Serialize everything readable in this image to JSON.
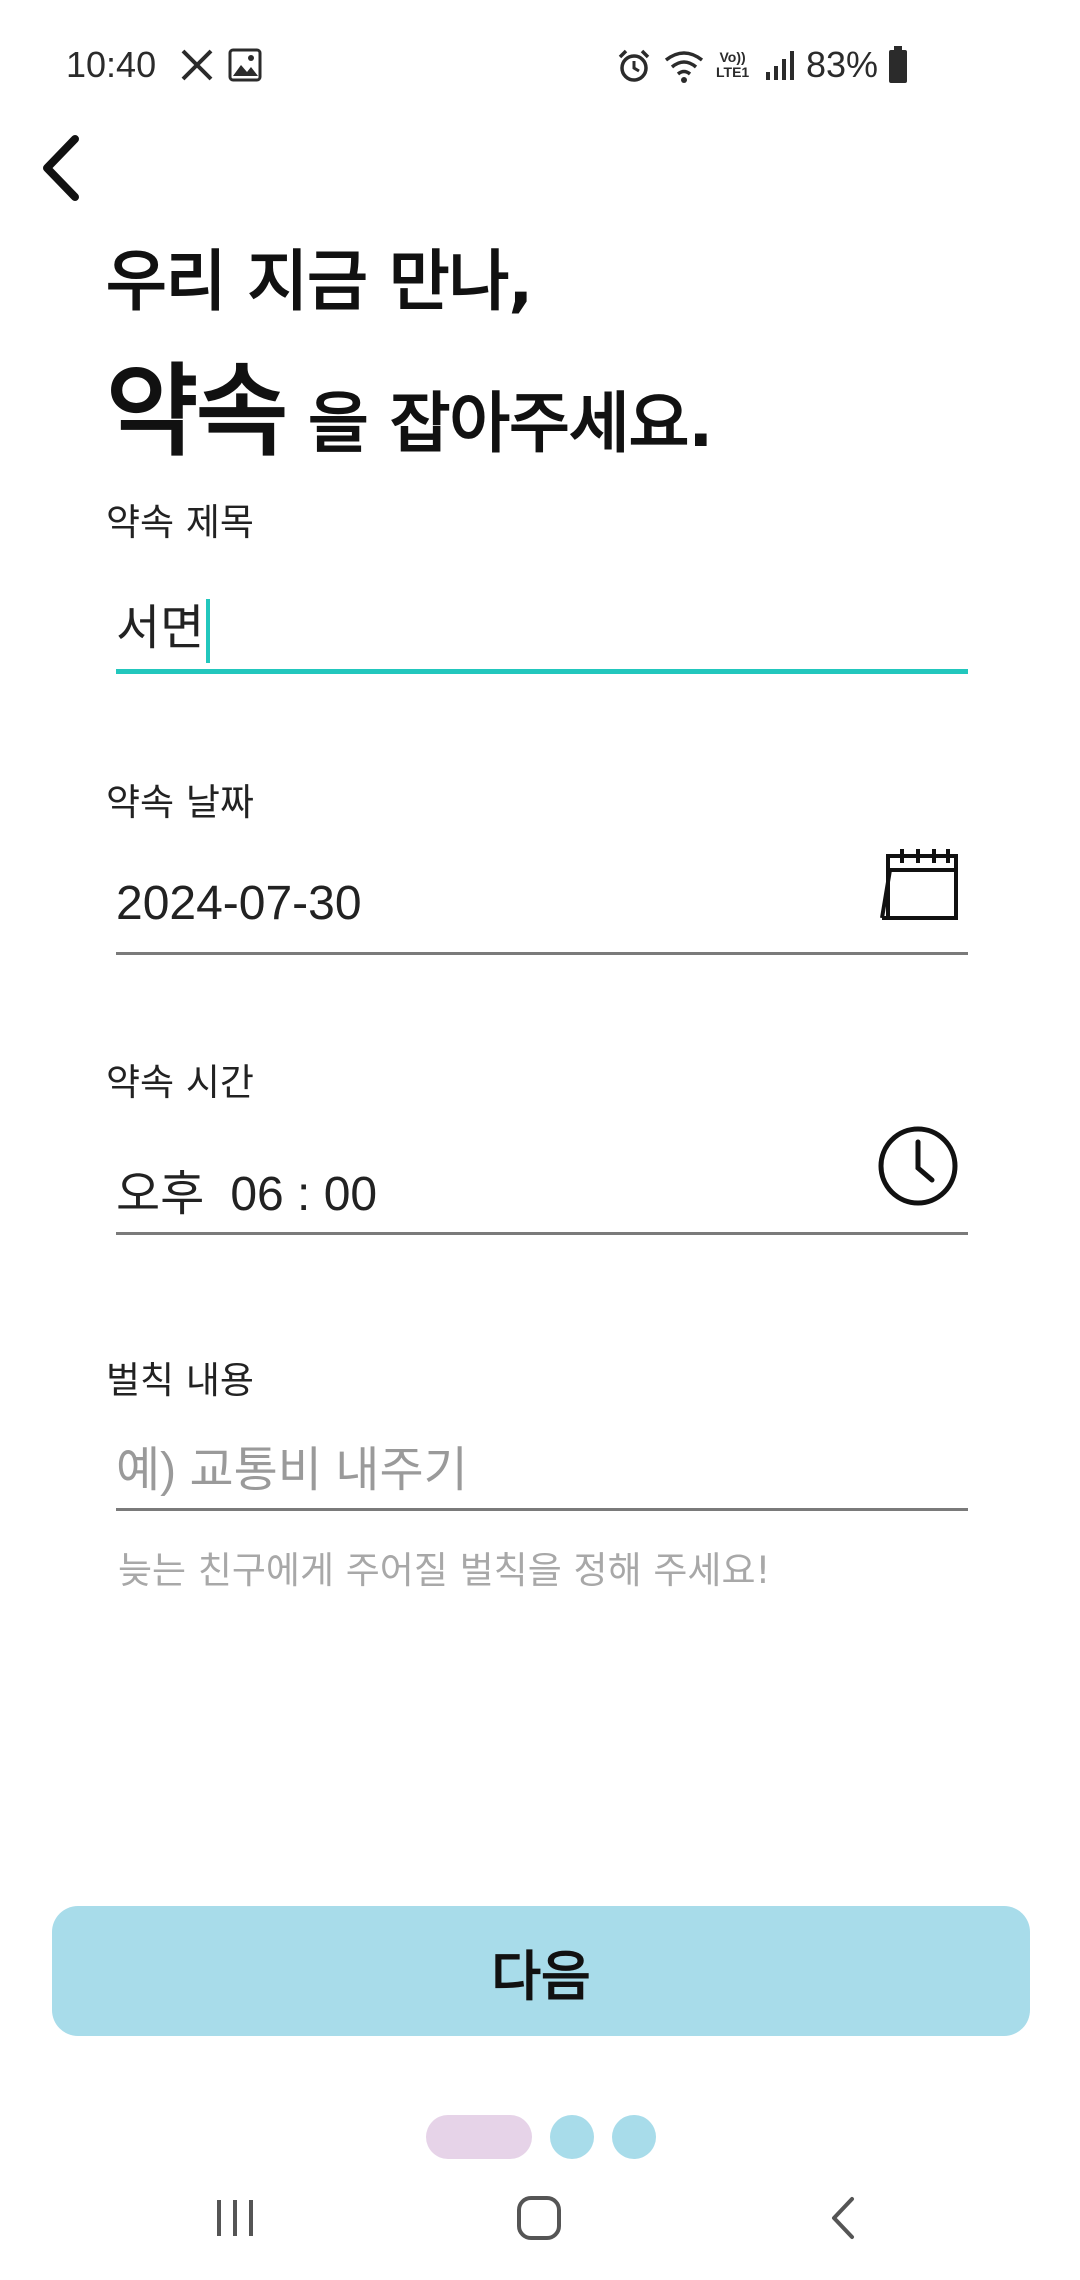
{
  "status_bar": {
    "time": "10:40",
    "battery": "83%",
    "icons": [
      "x-app-icon",
      "gallery-icon",
      "alarm-icon",
      "wifi-icon",
      "volte-lte-icon",
      "signal-icon",
      "battery-icon"
    ],
    "volte_top": "Vo))",
    "volte_bottom": "LTE1"
  },
  "header": {
    "back_icon": "chevron-left-icon",
    "line1": "우리 지금 만나,",
    "line2_emphasis": "약속",
    "line2_rest": "을 잡아주세요."
  },
  "form": {
    "title": {
      "label": "약속 제목",
      "value": "서면"
    },
    "date": {
      "label": "약속 날짜",
      "value": "2024-07-30",
      "icon": "calendar-icon"
    },
    "time": {
      "label": "약속 시간",
      "ampm": "오후",
      "value": "06 : 00",
      "icon": "clock-icon"
    },
    "penalty": {
      "label": "벌칙 내용",
      "placeholder": "예) 교통비 내주기",
      "helper": "늦는 친구에게 주어질 벌칙을 정해 주세요!"
    }
  },
  "next_button": {
    "label": "다음"
  },
  "pager": {
    "total": 3,
    "current": 1
  },
  "colors": {
    "accent": "#22c7bd",
    "button_bg": "#a8dcea",
    "dot_active": "#e6d3e8",
    "dot_inactive": "#a8dcea",
    "placeholder": "#9a9a9a"
  },
  "nav_bar": {
    "icons": [
      "recent-apps-icon",
      "home-icon",
      "back-nav-icon"
    ]
  }
}
